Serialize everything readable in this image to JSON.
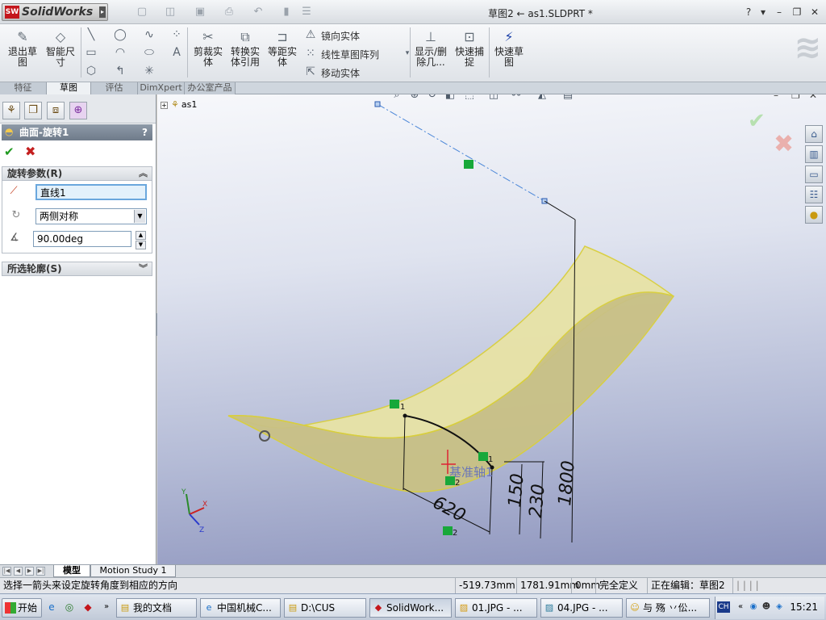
{
  "app": {
    "name": "SolidWorks",
    "logo_badge": "SW"
  },
  "title": {
    "document": "草图2 ← as1.SLDPRT *",
    "help": "?"
  },
  "toolbar": {
    "exit_sketch": "退出草图",
    "smart_dimension": "智能尺寸",
    "trim_entities": "剪裁实体",
    "convert_entities": "转换实体引用",
    "offset_entities": "等距实体",
    "mirror_entities": "镜向实体",
    "linear_pattern": "线性草图阵列",
    "move_entities": "移动实体",
    "display_relations": "显示/删除几...",
    "quick_snaps": "快速捕捉",
    "rapid_sketch": "快速草图"
  },
  "tabs": [
    {
      "label": "特征",
      "active": false
    },
    {
      "label": "草图",
      "active": true
    },
    {
      "label": "评估",
      "active": false
    },
    {
      "label": "DimXpert",
      "active": false
    },
    {
      "label": "办公室产品",
      "active": false
    }
  ],
  "property_manager": {
    "title": "曲面-旋转1",
    "help": "?",
    "ok": "✔",
    "cancel": "✖",
    "rotation_params": {
      "header": "旋转参数(R)",
      "axis": "直线1",
      "direction": "两侧对称",
      "angle": "90.00deg"
    },
    "selected_contours": {
      "header": "所选轮廓(S)"
    }
  },
  "viewport": {
    "tree_root": "as1",
    "axis_label": "基准轴1",
    "dimensions": [
      "620",
      "150",
      "230",
      "1800"
    ],
    "relation_tags": [
      "1",
      "1",
      "2",
      "2"
    ],
    "triad": {
      "x": "X",
      "y": "Y",
      "z": "Z"
    }
  },
  "model_tabs": [
    {
      "label": "模型",
      "active": true
    },
    {
      "label": "Motion Study 1",
      "active": false
    }
  ],
  "status": {
    "message": "选择一箭头来设定旋转角度到相应的方向",
    "x": "-519.73mm",
    "y": "1781.91mm",
    "z": "0mm",
    "definition": "完全定义",
    "editing": "正在编辑：草图2"
  },
  "taskbar": {
    "start": "开始",
    "windows": [
      {
        "label": "我的文档",
        "icon": "folder-icon",
        "active": false
      },
      {
        "label": "中国机械C...",
        "icon": "browser-icon",
        "active": false
      },
      {
        "label": "D:\\CUS",
        "icon": "folder-icon",
        "active": false
      },
      {
        "label": "SolidWork...",
        "icon": "solidworks-icon",
        "active": true
      },
      {
        "label": "01.JPG - ...",
        "icon": "image-icon",
        "active": false
      },
      {
        "label": "04.JPG - ...",
        "icon": "image-icon",
        "active": false
      },
      {
        "label": "与 殇 丷伀...",
        "icon": "qq-icon",
        "active": false
      }
    ],
    "clock": "15:21",
    "ime": "CH"
  },
  "colors": {
    "surface_fill": "#e9e6a8",
    "surface_edge": "#e2d94a",
    "axis_line": "#4a86d8",
    "relation_green": "#18a83a",
    "ok_green": "#1f9a1f",
    "cancel_red": "#c41f1f"
  }
}
